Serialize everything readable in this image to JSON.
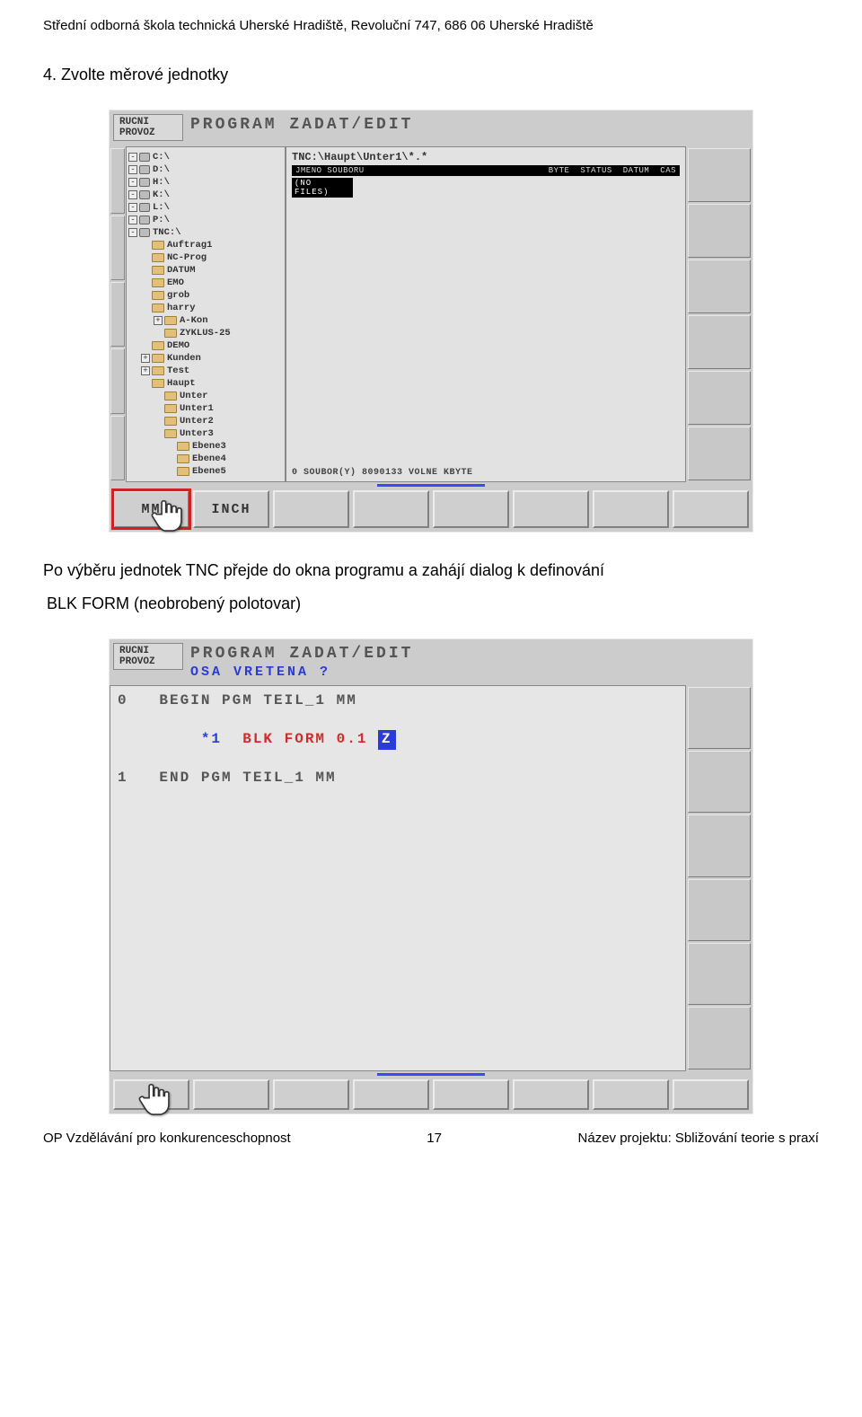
{
  "doc": {
    "header": "Střední odborná škola technická Uherské Hradiště, Revoluční 747, 686 06 Uherské Hradiště",
    "section_title": "4. Zvolte měrové jednotky",
    "body1": "Po výběru jednotek TNC přejde do okna programu a zahájí dialog k definování",
    "body2": "BLK FORM (neobrobený polotovar)",
    "footer_left": "OP Vzdělávání pro konkurenceschopnost",
    "page_number": "17",
    "footer_right": "Název projektu: Sbližování teorie s praxí"
  },
  "screen1": {
    "mode_line1": "RUCNI",
    "mode_line2": "PROVOZ",
    "title": "PROGRAM ZADAT/EDIT",
    "path": "TNC:\\Haupt\\Unter1\\*.*",
    "col_headers": [
      "JMENO SOUBORU",
      "BYTE",
      "STATUS",
      "DATUM",
      "CAS"
    ],
    "no_files": "(NO FILES)",
    "status": "0   SOUBOR(Y) 8090133 VOLNE KBYTE",
    "tree": [
      {
        "lvl": 0,
        "exp": "-",
        "type": "disk",
        "label": "C:\\"
      },
      {
        "lvl": 0,
        "exp": "-",
        "type": "disk",
        "label": "D:\\"
      },
      {
        "lvl": 0,
        "exp": "-",
        "type": "disk",
        "label": "H:\\"
      },
      {
        "lvl": 0,
        "exp": "-",
        "type": "disk",
        "label": "K:\\"
      },
      {
        "lvl": 0,
        "exp": "-",
        "type": "disk",
        "label": "L:\\"
      },
      {
        "lvl": 0,
        "exp": "-",
        "type": "disk",
        "label": "P:\\"
      },
      {
        "lvl": 0,
        "exp": "-",
        "type": "disk",
        "label": "TNC:\\"
      },
      {
        "lvl": 1,
        "exp": "",
        "type": "folder",
        "label": "Auftrag1"
      },
      {
        "lvl": 1,
        "exp": "",
        "type": "folder",
        "label": "NC-Prog"
      },
      {
        "lvl": 1,
        "exp": "",
        "type": "folder",
        "label": "DATUM"
      },
      {
        "lvl": 1,
        "exp": "",
        "type": "folder",
        "label": "EMO"
      },
      {
        "lvl": 1,
        "exp": "",
        "type": "folder",
        "label": "grob"
      },
      {
        "lvl": 1,
        "exp": "",
        "type": "folder",
        "label": "harry"
      },
      {
        "lvl": 2,
        "exp": "+",
        "type": "folder",
        "label": "A-Kon"
      },
      {
        "lvl": 2,
        "exp": "",
        "type": "folder",
        "label": "ZYKLUS-25"
      },
      {
        "lvl": 1,
        "exp": "",
        "type": "folder",
        "label": "DEMO"
      },
      {
        "lvl": 1,
        "exp": "+",
        "type": "folder",
        "label": "Kunden"
      },
      {
        "lvl": 1,
        "exp": "+",
        "type": "folder",
        "label": "Test"
      },
      {
        "lvl": 1,
        "exp": "",
        "type": "folder",
        "label": "Haupt"
      },
      {
        "lvl": 2,
        "exp": "",
        "type": "folder",
        "label": "Unter"
      },
      {
        "lvl": 2,
        "exp": "",
        "type": "folder",
        "label": "Unter1"
      },
      {
        "lvl": 2,
        "exp": "",
        "type": "folder",
        "label": "Unter2"
      },
      {
        "lvl": 2,
        "exp": "",
        "type": "folder",
        "label": "Unter3"
      },
      {
        "lvl": 3,
        "exp": "",
        "type": "folder",
        "label": "Ebene3"
      },
      {
        "lvl": 3,
        "exp": "",
        "type": "folder",
        "label": "Ebene4"
      },
      {
        "lvl": 3,
        "exp": "",
        "type": "folder",
        "label": "Ebene5"
      }
    ],
    "softkeys": [
      {
        "label": "MM",
        "selected": true
      },
      {
        "label": "INCH",
        "selected": false
      },
      {
        "label": "",
        "selected": false
      },
      {
        "label": "",
        "selected": false
      },
      {
        "label": "",
        "selected": false
      },
      {
        "label": "",
        "selected": false
      },
      {
        "label": "",
        "selected": false
      },
      {
        "label": "",
        "selected": false
      }
    ]
  },
  "screen2": {
    "mode_line1": "RUCNI",
    "mode_line2": "PROVOZ",
    "title": "PROGRAM ZADAT/EDIT",
    "subtitle": "OSA VRETENA ?",
    "code": {
      "l0_pre": "0   BEGIN PGM TEIL_1 MM",
      "l1_star": "*1",
      "l1_mid": "  BLK FORM 0.1 ",
      "l1_box": "Z",
      "l2": "1   END PGM TEIL_1 MM"
    },
    "softkeys": [
      "",
      "",
      "",
      "",
      "",
      "",
      "",
      ""
    ]
  }
}
